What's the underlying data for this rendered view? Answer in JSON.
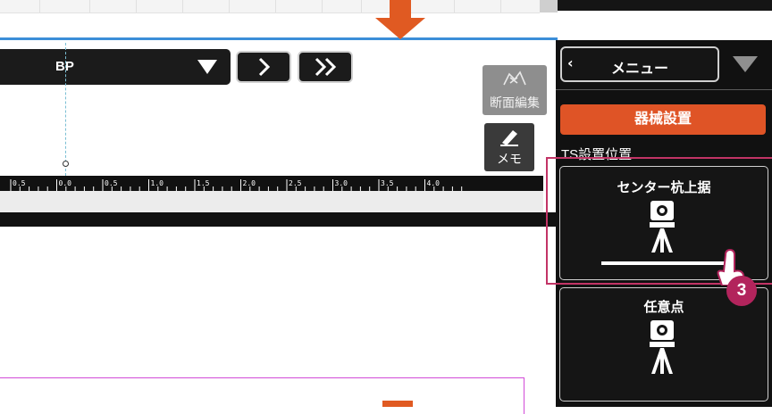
{
  "toolbar": {
    "station_label": "BP",
    "next_icon": "chevron-right",
    "fast_forward_icon": "double-chevron-right"
  },
  "side_tools": {
    "section_edit_label": "断面編集",
    "memo_label": "メモ"
  },
  "ruler": {
    "tick_labels": [
      "0.5",
      "0.0",
      "0.5",
      "1.0",
      "1.5",
      "2.0",
      "2.5",
      "3.0",
      "3.5",
      "4.0"
    ]
  },
  "panel": {
    "menu_label": "メニュー",
    "back_icon": "chevron-left",
    "instrument_setup_tab": "器械設置",
    "ts_position_label": "TS設置位置",
    "options": [
      {
        "title": "センター杭上据",
        "icon": "total-station-on-line"
      },
      {
        "title": "任意点",
        "icon": "total-station"
      }
    ]
  },
  "annotation": {
    "step_number": "3",
    "highlight_color": "#c23466",
    "accent_color": "#df5426"
  }
}
